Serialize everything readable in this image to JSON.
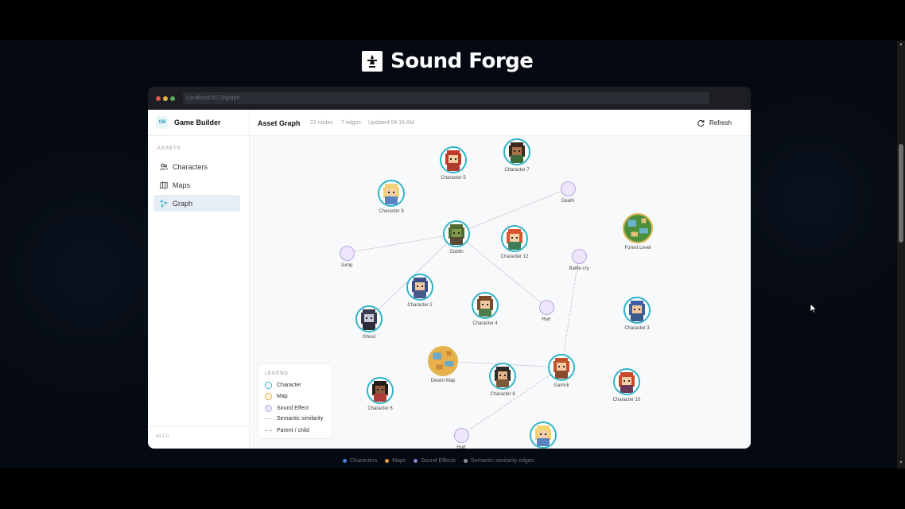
{
  "brand": {
    "title": "Sound Forge",
    "icon": "forge-logo-icon"
  },
  "browser": {
    "url": "Localhost:5173/graph"
  },
  "sidebar": {
    "app_title": "Game Builder",
    "logo_text": "GB",
    "section_label": "ASSETS",
    "items": [
      {
        "label": "Characters",
        "icon": "users-icon",
        "active": false
      },
      {
        "label": "Maps",
        "icon": "map-icon",
        "active": false
      },
      {
        "label": "Graph",
        "icon": "graph-icon",
        "active": true
      }
    ],
    "version": "v0.1.0"
  },
  "topbar": {
    "title": "Asset Graph",
    "nodes_count": "21 nodes",
    "edges_count": "7 edges",
    "updated": "Updated 04:18 AM",
    "refresh_label": "Refresh"
  },
  "graph": {
    "colors": {
      "character": "#2fb3c6",
      "map": "#e0b24a",
      "sfx": "#b9a6e4",
      "edge": "#c9cdd3"
    },
    "nodes": [
      {
        "id": "c5",
        "label": "Character 5",
        "kind": "character",
        "hair": "#c0392b",
        "skin": "#f2c9a0",
        "shirt": "#b03a2e"
      },
      {
        "id": "c7",
        "label": "Character 7",
        "kind": "character",
        "hair": "#3b2a1e",
        "skin": "#a8734d",
        "shirt": "#3e6b3a"
      },
      {
        "id": "c9",
        "label": "Character 9",
        "kind": "character",
        "hair": "#f1d27a",
        "skin": "#f4cfa8",
        "shirt": "#5b83c2"
      },
      {
        "id": "death",
        "label": "Death",
        "kind": "sfx"
      },
      {
        "id": "goblin",
        "label": "Goblin",
        "kind": "character",
        "hair": "#4f6b2f",
        "skin": "#7f9a4a",
        "shirt": "#5a4a3a"
      },
      {
        "id": "c12",
        "label": "Character 12",
        "kind": "character",
        "hair": "#d9542b",
        "skin": "#f4cfa8",
        "shirt": "#3f7d5a"
      },
      {
        "id": "forest",
        "label": "Forest Level",
        "kind": "map",
        "palette": [
          "#4a8f3c",
          "#6db3c9",
          "#e0c27a"
        ]
      },
      {
        "id": "jump",
        "label": "Jump",
        "kind": "sfx"
      },
      {
        "id": "battlecry",
        "label": "Battle cry",
        "kind": "sfx"
      },
      {
        "id": "c2",
        "label": "Character 2",
        "kind": "character",
        "hair": "#3a4e8c",
        "skin": "#f2c9a0",
        "shirt": "#4a5a8a"
      },
      {
        "id": "c4",
        "label": "Character 4",
        "kind": "character",
        "hair": "#7a4a28",
        "skin": "#f2c9a0",
        "shirt": "#4f7a4a"
      },
      {
        "id": "hurt1",
        "label": "Hurt",
        "kind": "sfx"
      },
      {
        "id": "c3",
        "label": "Character 3",
        "kind": "character",
        "hair": "#3d5fa8",
        "skin": "#f2c9a0",
        "shirt": "#3a5a8a"
      },
      {
        "id": "ghoul",
        "label": "Ghoul",
        "kind": "character",
        "hair": "#3b3b4f",
        "skin": "#c8c8d8",
        "shirt": "#2b2b3a"
      },
      {
        "id": "desert",
        "label": "Desert Map",
        "kind": "map",
        "palette": [
          "#e7b04a",
          "#6aa7c9",
          "#c98a3a"
        ]
      },
      {
        "id": "c8",
        "label": "Character 8",
        "kind": "character",
        "hair": "#2e2a26",
        "skin": "#e3b48a",
        "shirt": "#7a5a3a"
      },
      {
        "id": "garrick",
        "label": "Garrick",
        "kind": "character",
        "hair": "#c0522b",
        "skin": "#f2c9a0",
        "shirt": "#8a4a2a"
      },
      {
        "id": "c10",
        "label": "Character 10",
        "kind": "character",
        "hair": "#c9492b",
        "skin": "#f4cfa8",
        "shirt": "#6a3a5a"
      },
      {
        "id": "c6",
        "label": "Character 6",
        "kind": "character",
        "hair": "#2a1e1a",
        "skin": "#8a5a3a",
        "shirt": "#b03a3a"
      },
      {
        "id": "hurt2",
        "label": "Hurt",
        "kind": "sfx"
      },
      {
        "id": "blonde",
        "label": "",
        "kind": "character",
        "hair": "#f3d36e",
        "skin": "#f4cfa8",
        "shirt": "#5b83c2"
      }
    ],
    "edges": [
      {
        "from": "goblin",
        "to": "jump",
        "style": "similarity"
      },
      {
        "from": "goblin",
        "to": "death",
        "style": "similarity"
      },
      {
        "from": "goblin",
        "to": "hurt1",
        "style": "similarity"
      },
      {
        "from": "goblin",
        "to": "ghoul",
        "style": "similarity"
      },
      {
        "from": "desert",
        "to": "garrick",
        "style": "similarity"
      },
      {
        "from": "garrick",
        "to": "battlecry",
        "style": "parent"
      },
      {
        "from": "garrick",
        "to": "hurt2",
        "style": "parent"
      }
    ]
  },
  "legend": {
    "title": "LEGEND",
    "items": [
      {
        "label": "Character",
        "kind": "character"
      },
      {
        "label": "Map",
        "kind": "map"
      },
      {
        "label": "Sound Effect",
        "kind": "sfx"
      },
      {
        "label": "Semantic similarity",
        "kind": "line"
      },
      {
        "label": "Parent / child",
        "kind": "dash"
      }
    ]
  },
  "footer": {
    "items": [
      {
        "label": "Characters",
        "color": "#3f7fd6"
      },
      {
        "label": "Maps",
        "color": "#e0a23a"
      },
      {
        "label": "Sound Effects",
        "color": "#8f7fd6"
      },
      {
        "label": "Semantic similarity edges",
        "color": "#8a93a3"
      }
    ]
  }
}
